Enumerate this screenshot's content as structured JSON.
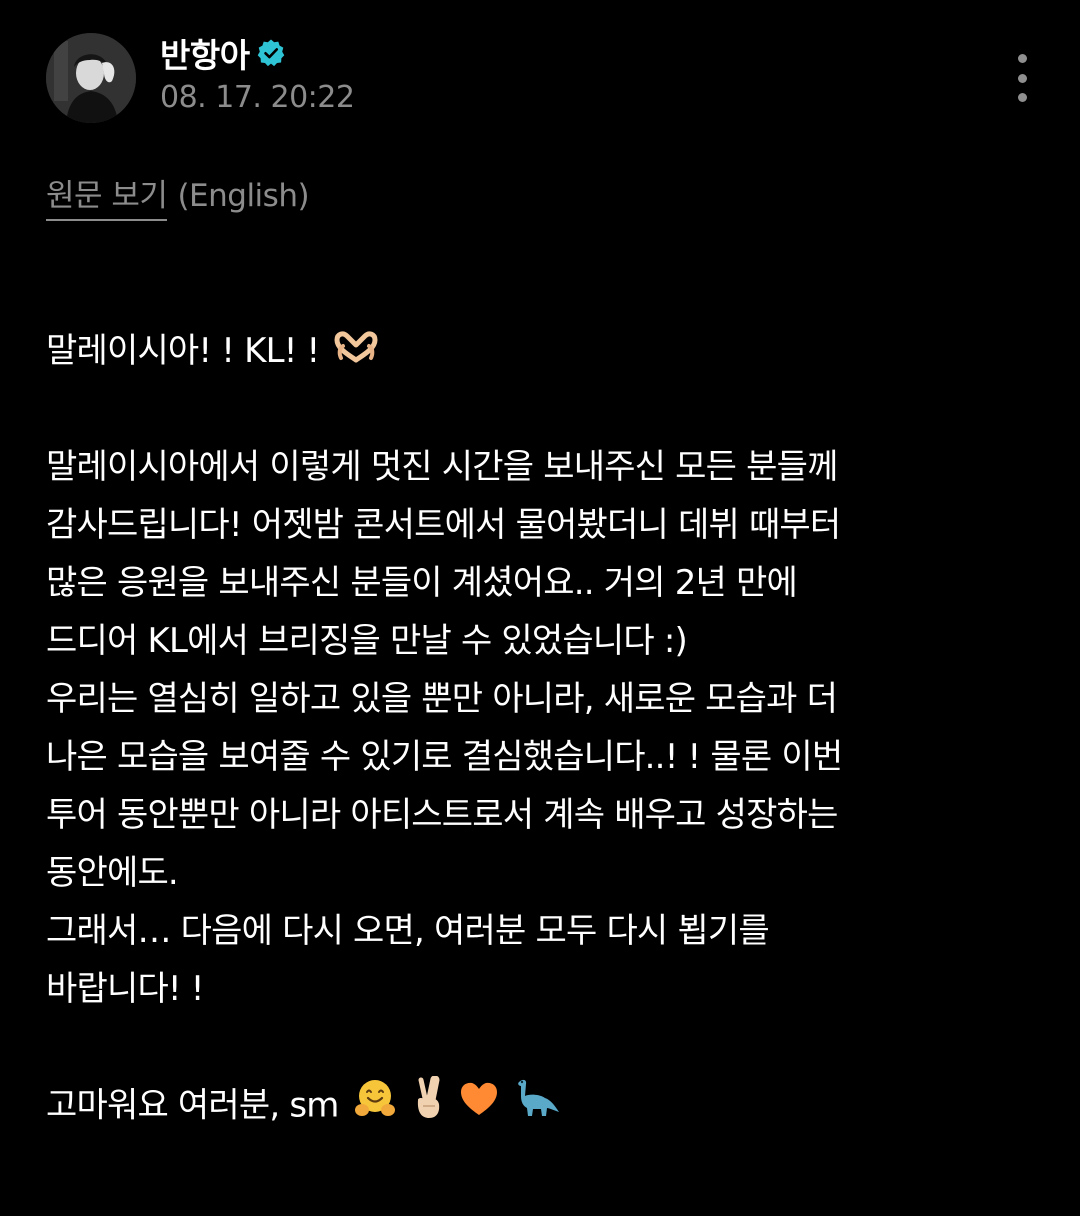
{
  "post": {
    "author": {
      "name": "반항아",
      "verified": true,
      "avatar_icon": "avatar-photo"
    },
    "timestamp": "08. 17. 20:22",
    "translate": {
      "view_original_label": "원문 보기",
      "source_language": "(English)"
    },
    "body": {
      "heading_text": "말레이시아! !  KL! !",
      "heading_emoji": "heart-hands-emoji",
      "lines": [
        "말레이시아에서 이렇게 멋진 시간을 보내주신 모든 분들께",
        "감사드립니다!  어젯밤 콘서트에서 물어봤더니 데뷔 때부터",
        "많은 응원을 보내주신 분들이 계셨어요.. 거의 2년 만에",
        "드디어 KL에서 브리징을 만날 수 있었습니다 :)",
        "우리는 열심히 일하고 있을 뿐만 아니라, 새로운 모습과 더",
        "나은 모습을 보여줄 수 있기로 결심했습니다..! !  물론 이번",
        "투어 동안뿐만 아니라 아티스트로서 계속 배우고 성장하는",
        "동안에도.",
        "그래서… 다음에 다시 오면, 여러분 모두 다시 뵙기를",
        "바랍니다! !"
      ],
      "closing_text": "고마워요 여러분, sm",
      "closing_emojis": [
        "hugging-face-emoji",
        "victory-hand-emoji",
        "orange-heart-emoji",
        "sauropod-emoji"
      ]
    },
    "more_menu_icon": "vertical-ellipsis-icon"
  },
  "colors": {
    "background": "#000000",
    "text_primary": "#ffffff",
    "text_secondary": "#8c8c8c",
    "verified_badge": "#2ec4d6"
  }
}
